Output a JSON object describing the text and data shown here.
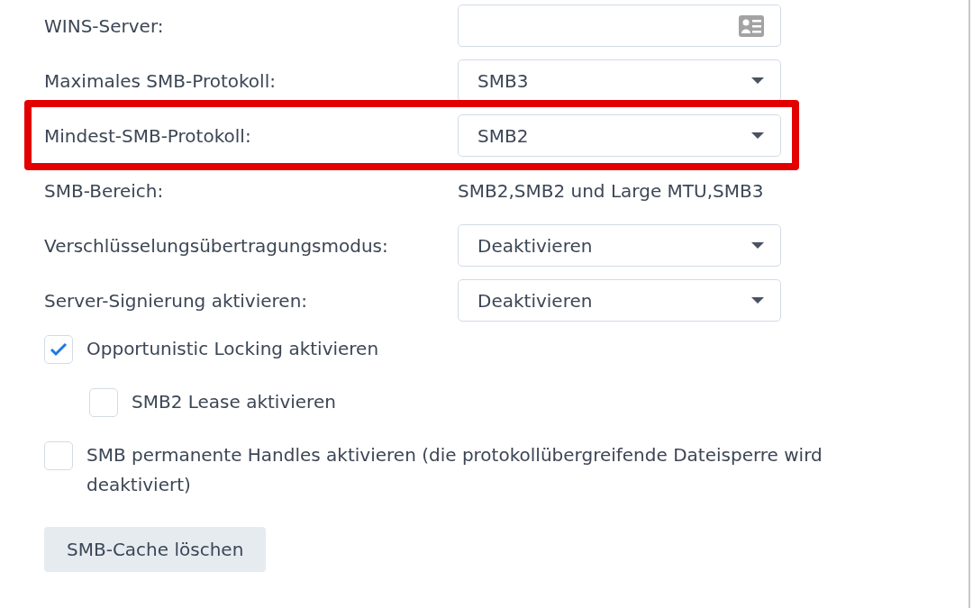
{
  "rows": [
    {
      "kind": "field",
      "label": "WINS-Server:",
      "value": ""
    },
    {
      "kind": "select",
      "label": "Maximales SMB-Protokoll:",
      "value": "SMB3"
    },
    {
      "kind": "select",
      "label": "Mindest-SMB-Protokoll:",
      "value": "SMB2",
      "highlighted": true
    },
    {
      "kind": "text",
      "label": "SMB-Bereich:",
      "value": "SMB2,SMB2 und Large MTU,SMB3"
    },
    {
      "kind": "select",
      "label": "Verschlüsselungsübertragungsmodus:",
      "value": "Deaktivieren"
    },
    {
      "kind": "select",
      "label": "Server-Signierung aktivieren:",
      "value": "Deaktivieren"
    }
  ],
  "checkboxes": [
    {
      "label": "Opportunistic Locking aktivieren",
      "checked": true,
      "children": [
        {
          "label": "SMB2 Lease aktivieren",
          "checked": false
        }
      ]
    },
    {
      "label": "SMB permanente Handles aktivieren (die protokollübergreifende Dateisperre wird deaktiviert)",
      "checked": false
    }
  ],
  "button": "SMB-Cache löschen"
}
